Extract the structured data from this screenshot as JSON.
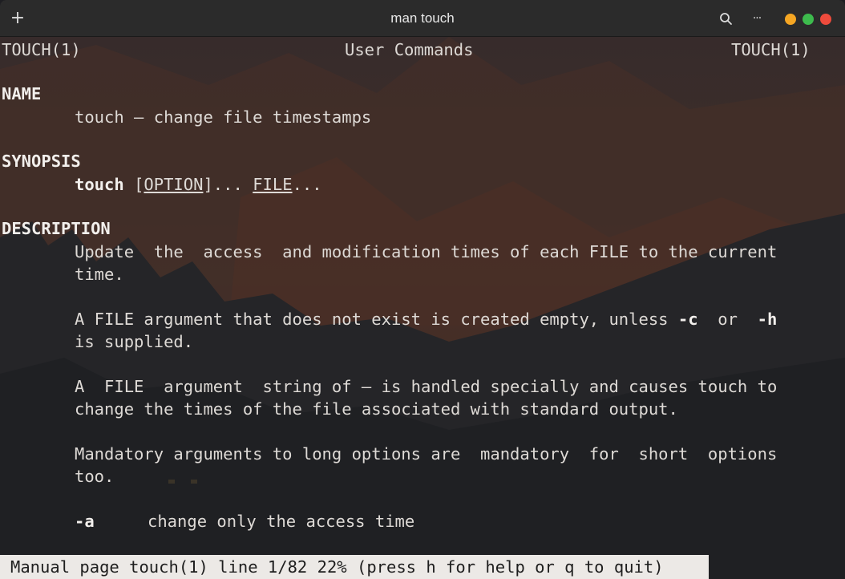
{
  "window": {
    "title": "man touch",
    "new_tab_icon": "plus-icon",
    "search_icon": "search-icon",
    "menu_icon": "ellipsis-icon",
    "menu_glyph": "···",
    "new_tab_glyph": "+",
    "controls": {
      "minimize_color": "#f5a623",
      "maximize_color": "#3dbb4d",
      "close_color": "#ee4b3c"
    }
  },
  "man": {
    "header_left": "TOUCH(1)",
    "header_center": "User Commands",
    "header_right": "TOUCH(1)",
    "name_heading": "NAME",
    "name_text": "touch – change file timestamps",
    "synopsis_heading": "SYNOPSIS",
    "synopsis_cmd": "touch",
    "synopsis_open": "[",
    "synopsis_option": "OPTION",
    "synopsis_mid": "]...",
    "synopsis_file": "FILE",
    "synopsis_end": "...",
    "description_heading": "DESCRIPTION",
    "desc_p1_l1": "Update  the  access  and modification times of each FILE to the current",
    "desc_p1_l2": "time.",
    "desc_p2_l1_a": "A FILE argument that does not exist is created empty, unless ",
    "desc_p2_flag_c": "-c",
    "desc_p2_l1_b": "  or  ",
    "desc_p2_flag_h": "-h",
    "desc_p2_l2": "is supplied.",
    "desc_p3_l1": "A  FILE  argument  string of – is handled specially and causes touch to",
    "desc_p3_l2": "change the times of the file associated with standard output.",
    "desc_p4_l1": "Mandatory arguments to long options are  mandatory  for  short  options",
    "desc_p4_l2": "too.",
    "opt_a_flag": "-a",
    "opt_a_text": "change only the access time"
  },
  "status_bar": {
    "text": "Manual page touch(1) line 1/82 22% (press h for help or q to quit)"
  }
}
